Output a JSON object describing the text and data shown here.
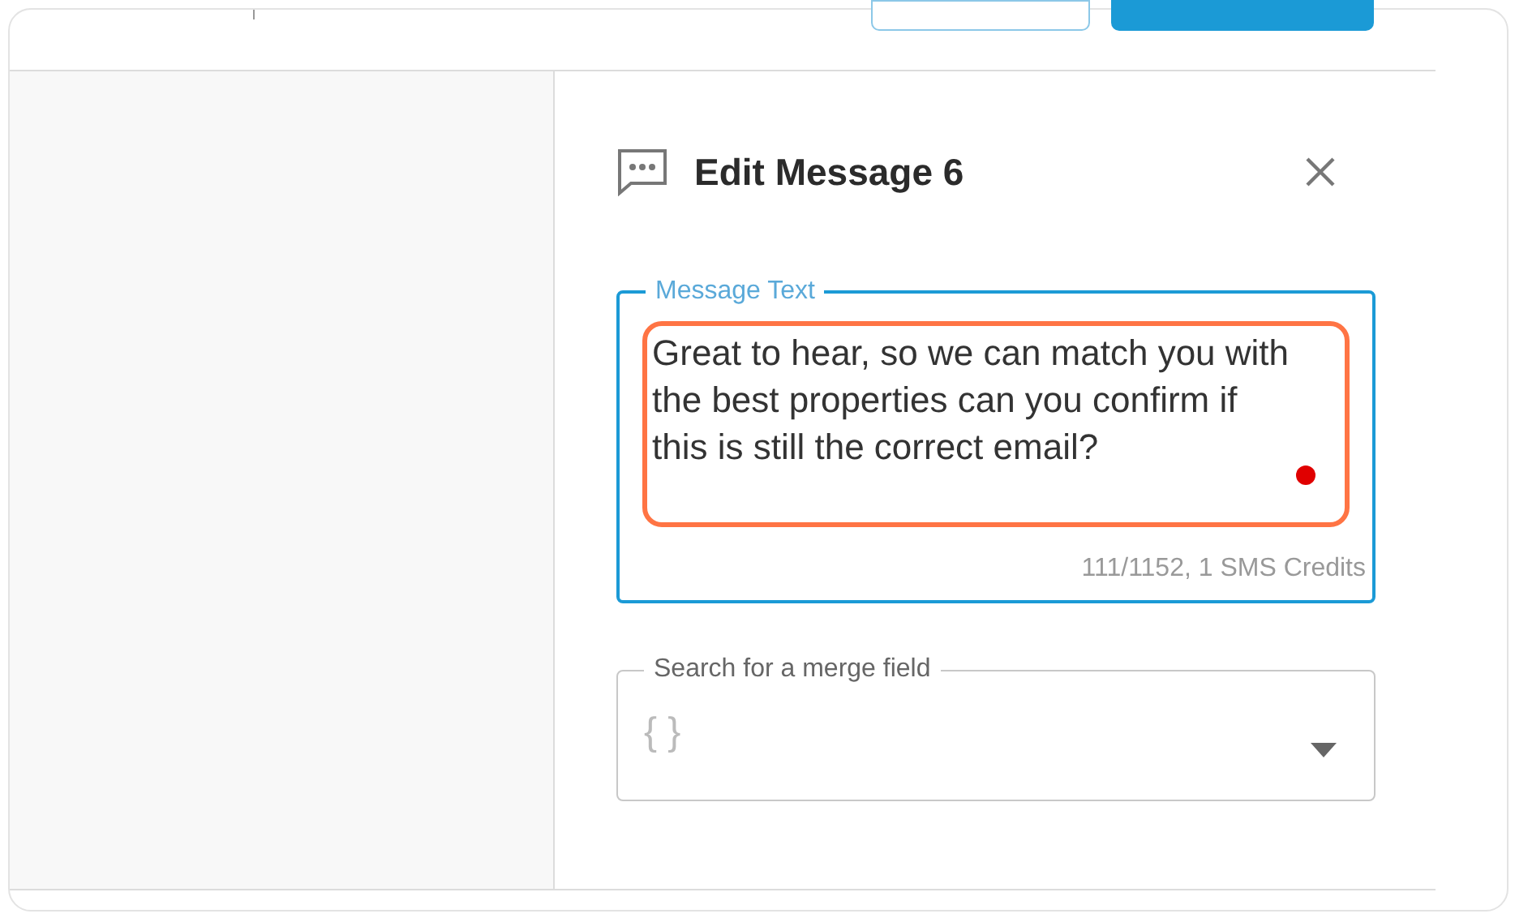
{
  "panel": {
    "title": "Edit Message 6"
  },
  "message_field": {
    "label": "Message Text",
    "value": "Great to hear, so we can match you with the best properties can you confirm if this is still the correct email?",
    "counter": "111/1152, 1 SMS Credits"
  },
  "merge_field": {
    "label": "Search for a merge field",
    "placeholder": "{ }"
  }
}
